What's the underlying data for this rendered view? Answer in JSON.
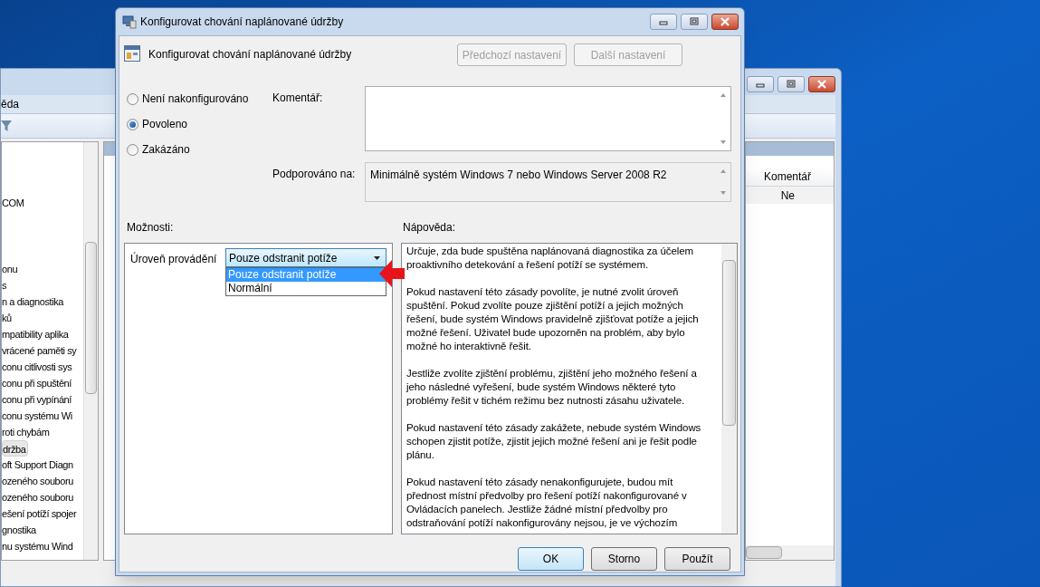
{
  "background_window": {
    "menu_fragment": "ěda",
    "tree_items": [
      {
        "label": "COM",
        "selected": false
      },
      {
        "label": "onu",
        "selected": false
      },
      {
        "label": "s",
        "selected": false
      },
      {
        "label": "n a diagnostika",
        "selected": false
      },
      {
        "label": "ků",
        "selected": false
      },
      {
        "label": "mpatibility aplika",
        "selected": false
      },
      {
        "label": "vrácené paměti sy",
        "selected": false
      },
      {
        "label": "conu citlivosti sys",
        "selected": false
      },
      {
        "label": "conu při spuštění",
        "selected": false
      },
      {
        "label": "conu při vypínání",
        "selected": false
      },
      {
        "label": "conu systému Wi",
        "selected": false
      },
      {
        "label": "roti chybám",
        "selected": false
      },
      {
        "label": "držba",
        "selected": true
      },
      {
        "label": "oft Support Diagn",
        "selected": false
      },
      {
        "label": "ozeného souboru",
        "selected": false
      },
      {
        "label": "ozeného souboru",
        "selected": false
      },
      {
        "label": "ešení potíží spojer",
        "selected": false
      },
      {
        "label": "gnostika",
        "selected": false
      },
      {
        "label": "nu systému Wind",
        "selected": false
      }
    ],
    "table": {
      "columns": [
        "Komentář"
      ],
      "rows": [
        [
          "Ne"
        ]
      ]
    }
  },
  "dialog": {
    "title": "Konfigurovat chování naplánované údržby",
    "header": "Konfigurovat chování naplánované údržby",
    "nav_buttons": [
      {
        "label": "Předchozí nastavení",
        "disabled": true
      },
      {
        "label": "Další nastavení",
        "disabled": true
      }
    ],
    "radios": [
      {
        "label": "Není nakonfigurováno",
        "selected": false
      },
      {
        "label": "Povoleno",
        "selected": true
      },
      {
        "label": "Zakázáno",
        "selected": false
      }
    ],
    "comment_label": "Komentář:",
    "supported_label": "Podporováno na:",
    "supported_value": "Minimálně systém Windows 7 nebo Windows Server 2008 R2",
    "options_label": "Možnosti:",
    "help_label": "Nápověda:",
    "option": {
      "label": "Úroveň provádění",
      "value": "Pouze odstranit potíže",
      "dropdown": [
        {
          "label": "Pouze odstranit potíže",
          "selected": true
        },
        {
          "label": "Normální",
          "selected": false
        }
      ]
    },
    "help_paragraphs": [
      [
        "Určuje, zda bude spuštěna naplánovaná diagnostika za účelem",
        "proaktivního detekování a řešení potíží se systémem."
      ],
      [
        "Pokud nastavení této zásady povolíte, je nutné zvolit úroveň",
        "spuštění. Pokud zvolíte pouze zjištění potíží a jejich možných",
        "řešení, bude systém Windows pravidelně zjišťovat potíže a jejich",
        "možné řešení. Uživatel bude upozorněn na problém, aby bylo",
        "možné ho interaktivně řešit."
      ],
      [
        "Jestliže zvolíte zjištění problému, zjištění jeho možného řešení a",
        "jeho následné vyřešení, bude systém Windows některé tyto",
        "problémy řešit v tichém režimu bez nutnosti zásahu uživatele."
      ],
      [
        "Pokud nastavení této zásady zakážete, nebude systém Windows",
        "schopen zjistit potíže, zjistit jejich možné řešení ani je řešit podle",
        "plánu."
      ],
      [
        "Pokud nastavení této zásady nenakonfigurujete, budou mít",
        "přednost místní předvolby pro řešení potíží nakonfigurované v",
        "Ovládacích panelech. Jestliže žádné místní předvolby pro",
        "odstraňování potíží nakonfigurovány nejsou, je ve výchozím"
      ]
    ],
    "buttons": [
      "OK",
      "Storno",
      "Použít"
    ]
  }
}
